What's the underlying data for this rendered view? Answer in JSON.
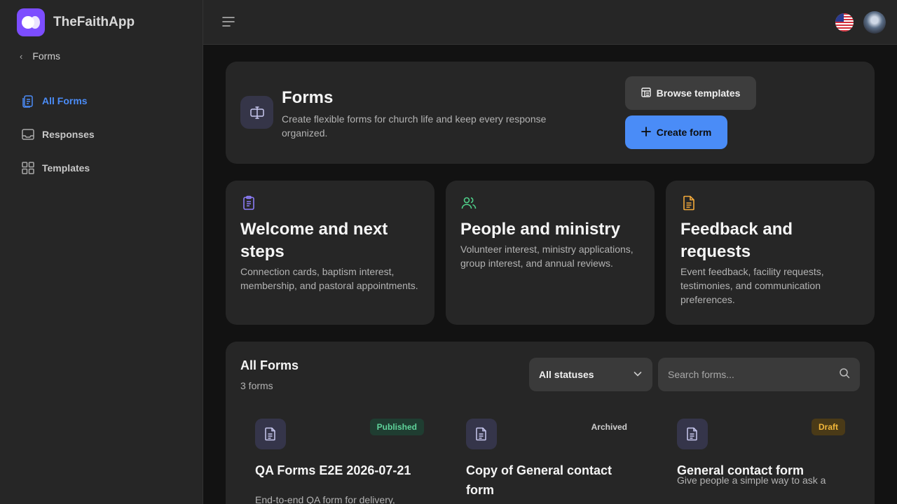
{
  "app": {
    "name": "TheFaithApp"
  },
  "sidebar": {
    "back_label": "Forms",
    "items": [
      {
        "label": "All Forms",
        "icon": "forms-icon",
        "active": true
      },
      {
        "label": "Responses",
        "icon": "inbox-icon",
        "active": false
      },
      {
        "label": "Templates",
        "icon": "grid-icon",
        "active": false
      }
    ]
  },
  "header": {
    "title": "Forms",
    "description": "Create flexible forms for church life and keep every response organized.",
    "browse_label": "Browse templates",
    "create_label": "Create form"
  },
  "categories": [
    {
      "title": "Welcome and next steps",
      "description": "Connection cards, baptism interest, membership, and pastoral appointments.",
      "icon": "clipboard-icon",
      "color": "#8b7cf6"
    },
    {
      "title": "People and ministry",
      "description": "Volunteer interest, ministry applications, group interest, and annual reviews.",
      "icon": "users-icon",
      "color": "#4fd08a"
    },
    {
      "title": "Feedback and requests",
      "description": "Event feedback, facility requests, testimonies, and communication preferences.",
      "icon": "document-icon",
      "color": "#f2a93b"
    }
  ],
  "forms_list": {
    "title": "All Forms",
    "count_label": "3 forms",
    "status_filter": "All statuses",
    "search_placeholder": "Search forms...",
    "forms": [
      {
        "title": "QA Forms E2E 2026-07-21",
        "status": "Published",
        "description": "End-to-end QA form for delivery,"
      },
      {
        "title": "Copy of General contact form",
        "status": "Archived",
        "description": ""
      },
      {
        "title": "General contact form",
        "status": "Draft",
        "description": "Give people a simple way to ask a"
      }
    ]
  },
  "colors": {
    "accent": "#4a8cf7",
    "brand": "#7c4dff"
  }
}
